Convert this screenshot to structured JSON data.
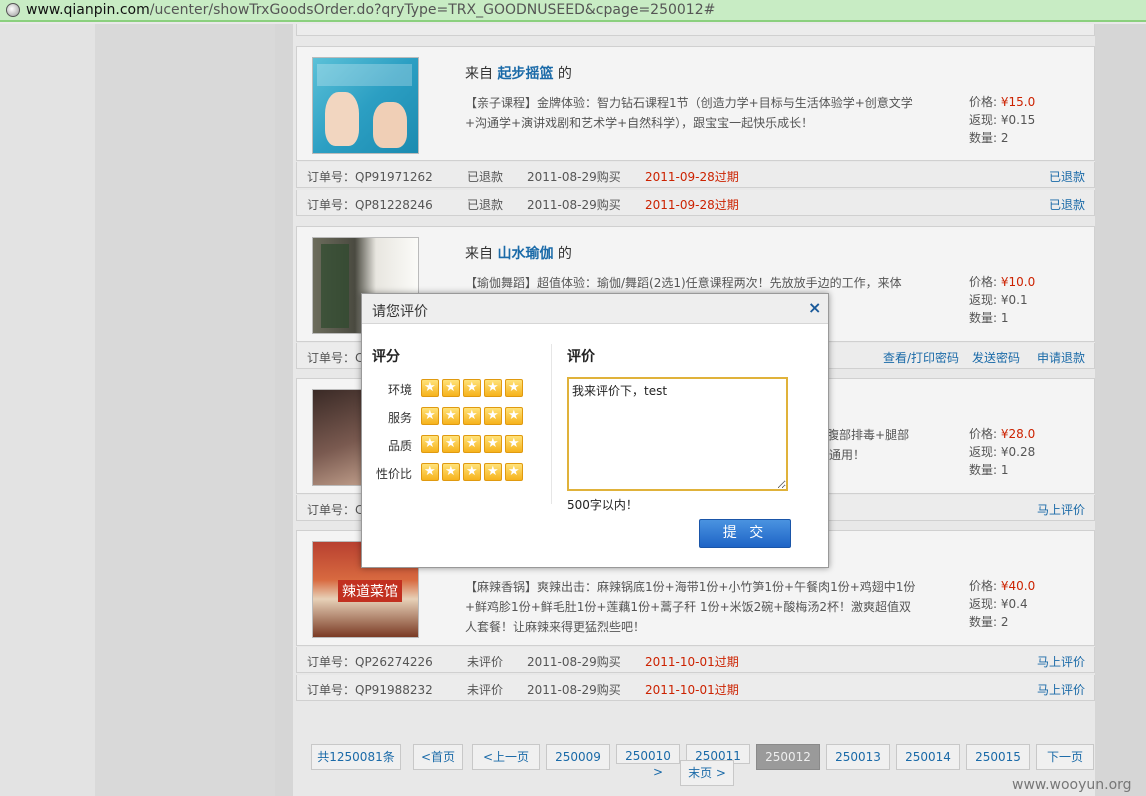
{
  "browser": {
    "url_host": "www.qianpin.com",
    "url_path": "/ucenter/showTrxGoodsOrder.do?qryType=TRX_GOODNUSEED&cpage=250012#"
  },
  "cards": [
    {
      "from_prefix": "来自",
      "shop": "起步摇篮",
      "from_suffix": "的",
      "desc": "【亲子课程】金牌体验：智力钻石课程1节（创造力学+目标与生活体验学+创意文学+沟通学+演讲戏剧和艺术学+自然科学），跟宝宝一起快乐成长！",
      "price_label": "价格:",
      "price": "¥15.0",
      "cashback_label": "返现:",
      "cashback": "¥0.15",
      "qty_label": "数量:",
      "qty": "2"
    },
    {
      "from_prefix": "来自",
      "shop": "山水瑜伽",
      "from_suffix": "的",
      "desc": "【瑜伽舞蹈】超值体验：瑜伽/舞蹈(2选1)任意课程两次！先放放手边的工作，来体",
      "price_label": "价格:",
      "price": "¥10.0",
      "cashback_label": "返现:",
      "cashback": "¥0.1",
      "qty_label": "数量:",
      "qty": "1"
    },
    {
      "desc_line1": "+腹部排毒+腿部",
      "desc_line2": "店通用！",
      "price_label": "价格:",
      "price": "¥28.0",
      "cashback_label": "返现:",
      "cashback": "¥0.28",
      "qty_label": "数量:",
      "qty": "1"
    },
    {
      "sign": "辣道菜馆",
      "desc": "【麻辣香锅】爽辣出击：麻辣锅底1份+海带1份+小竹笋1份+午餐肉1份+鸡翅中1份+鲜鸡胗1份+鲜毛肚1份+莲藕1份+蒿子秆 1份+米饭2碗+酸梅汤2杯！激爽超值双人套餐！让麻辣来得更猛烈些吧！",
      "price_label": "价格:",
      "price": "¥40.0",
      "cashback_label": "返现:",
      "cashback": "¥0.4",
      "qty_label": "数量:",
      "qty": "2"
    }
  ],
  "order_rows": [
    {
      "no": "订单号：QP91971262",
      "status": "已退款",
      "buy": "2011-08-29购买",
      "exp": "2011-09-28过期",
      "action": "已退款"
    },
    {
      "no": "订单号：QP81228246",
      "status": "已退款",
      "buy": "2011-08-29购买",
      "exp": "2011-09-28过期",
      "action": "已退款"
    },
    {
      "no": "订单号：C",
      "links": [
        "查看/打印密码",
        "发送密码",
        "申请退款"
      ]
    },
    {
      "no": "订单号：C",
      "action": "马上评价"
    },
    {
      "no": "订单号：QP26274226",
      "status": "未评价",
      "buy": "2011-08-29购买",
      "exp": "2011-10-01过期",
      "action": "马上评价"
    },
    {
      "no": "订单号：QP91988232",
      "status": "未评价",
      "buy": "2011-08-29购买",
      "exp": "2011-10-01过期",
      "action": "马上评价"
    }
  ],
  "pager": {
    "total": "共1250081条",
    "first": "<首页",
    "prev": "<上一页",
    "pages": [
      "250009",
      "250010",
      "250011",
      "250012",
      "250013",
      "250014",
      "250015"
    ],
    "current": "250012",
    "next": "下一页",
    "gt": ">",
    "last": "末页 >"
  },
  "watermark": "www.wooyun.org",
  "modal": {
    "title": "请您评价",
    "close": "×",
    "rating_title": "评分",
    "review_title": "评价",
    "criteria": [
      "环境",
      "服务",
      "品质",
      "性价比"
    ],
    "stars_per_row": 5,
    "review_text": "我来评价下，test",
    "limit_note": "500字以内！",
    "submit": "提 交"
  }
}
